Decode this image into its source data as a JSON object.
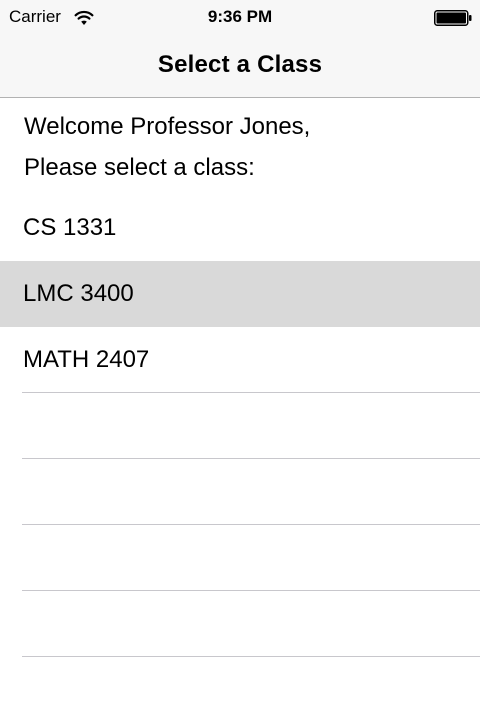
{
  "status_bar": {
    "carrier": "Carrier",
    "wifi_icon": "wifi-icon",
    "time": "9:36 PM",
    "battery_icon": "battery-full-icon"
  },
  "nav": {
    "title": "Select a Class"
  },
  "content": {
    "welcome": "Welcome Professor Jones,",
    "prompt": "Please select a class:"
  },
  "classes": [
    {
      "label": "CS 1331",
      "selected": false
    },
    {
      "label": "LMC 3400",
      "selected": true
    },
    {
      "label": "MATH 2407",
      "selected": false
    }
  ],
  "colors": {
    "nav_background": "#f7f7f7",
    "selected_row": "#d9d9d9",
    "separator": "#c8c7cc"
  }
}
